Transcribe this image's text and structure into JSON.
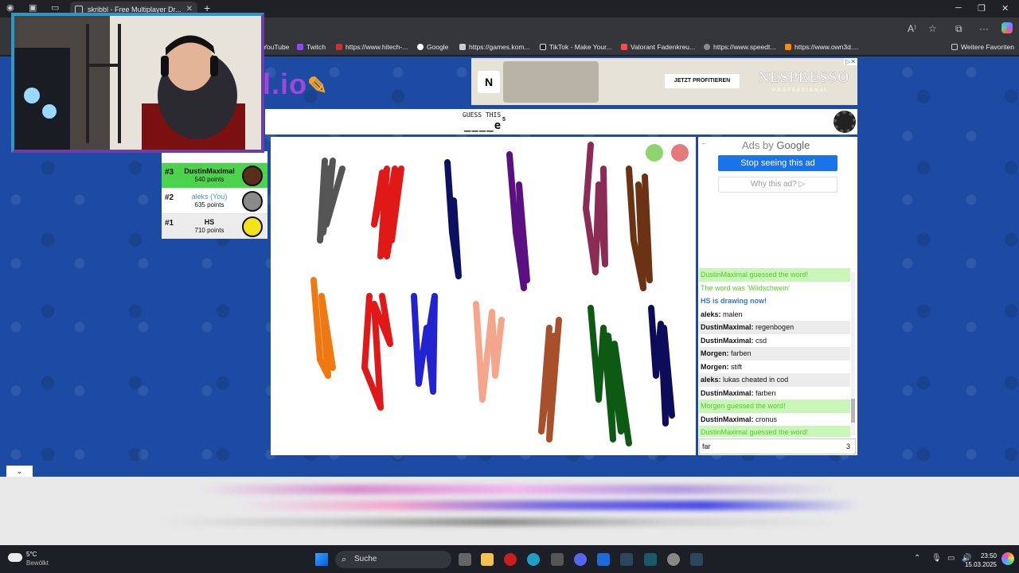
{
  "browser": {
    "tab_title": "skribbl - Free Multiplayer Dr...",
    "tab_close": "✕",
    "new_tab": "+",
    "bookmarks": [
      {
        "label": "YouTube",
        "color": "#ff0000"
      },
      {
        "label": "Twitch",
        "color": "#9146ff"
      },
      {
        "label": "https://www.hitech-...",
        "color": "#d32f2f"
      },
      {
        "label": "Google",
        "color": "#ffffff"
      },
      {
        "label": "https://games.kom...",
        "color": "#cccccc"
      },
      {
        "label": "TikTok - Make Your...",
        "color": "#222222"
      },
      {
        "label": "Valorant Fadenkreu...",
        "color": "#ff4655"
      },
      {
        "label": "https://www.speedt...",
        "color": "#888888"
      },
      {
        "label": "https://www.own3d....",
        "color": "#ff8a00"
      }
    ],
    "other_favorites": "Weitere Favoriten"
  },
  "game": {
    "logo_text": "l.io",
    "guess_label": "GUESS THIS",
    "guess_word": "____e",
    "guess_count": "5",
    "players": [
      {
        "rank": "#3",
        "name": "DustinMaximal",
        "points": "540 points",
        "guessed": true
      },
      {
        "rank": "#2",
        "name": "aleks (You)",
        "points": "635 points",
        "guessed": false
      },
      {
        "rank": "#1",
        "name": "HS",
        "points": "710 points",
        "guessed": false
      }
    ]
  },
  "ad_top": {
    "cta": "JETZT PROFITIEREN",
    "brand": "NESPRESSO",
    "brand_sub": "PROFESSIONAL",
    "logo_letter": "N"
  },
  "side_ad": {
    "ads_by": "Ads by",
    "google": "Google",
    "stop": "Stop seeing this ad",
    "why": "Why this ad? ▷"
  },
  "chat": {
    "messages": [
      {
        "kind": "green",
        "author": "",
        "text": "DustinMaximal guessed the word!"
      },
      {
        "kind": "greenplain",
        "author": "",
        "text": "The word was 'Wildschwein'"
      },
      {
        "kind": "blue",
        "author": "",
        "text": "HS is drawing now!"
      },
      {
        "kind": "plain",
        "author": "aleks:",
        "text": "malen"
      },
      {
        "kind": "shade",
        "author": "DustinMaximal:",
        "text": "regenbogen"
      },
      {
        "kind": "plain",
        "author": "DustinMaximal:",
        "text": "csd"
      },
      {
        "kind": "shade",
        "author": "Morgen:",
        "text": "farben"
      },
      {
        "kind": "plain",
        "author": "Morgen:",
        "text": "stift"
      },
      {
        "kind": "shade",
        "author": "aleks:",
        "text": "lukas cheated in cod"
      },
      {
        "kind": "plain",
        "author": "DustinMaximal:",
        "text": "farben"
      },
      {
        "kind": "green",
        "author": "",
        "text": "Morgen guessed the word!"
      },
      {
        "kind": "plain",
        "author": "DustinMaximal:",
        "text": "cronus"
      },
      {
        "kind": "green",
        "author": "",
        "text": "DustinMaximal guessed the word!"
      }
    ],
    "input_value": "far",
    "input_count": "3"
  },
  "taskbar": {
    "temp": "5°C",
    "weather": "Bewölkt",
    "search": "Suche",
    "time": "23:50",
    "date": "15.03.2025"
  }
}
